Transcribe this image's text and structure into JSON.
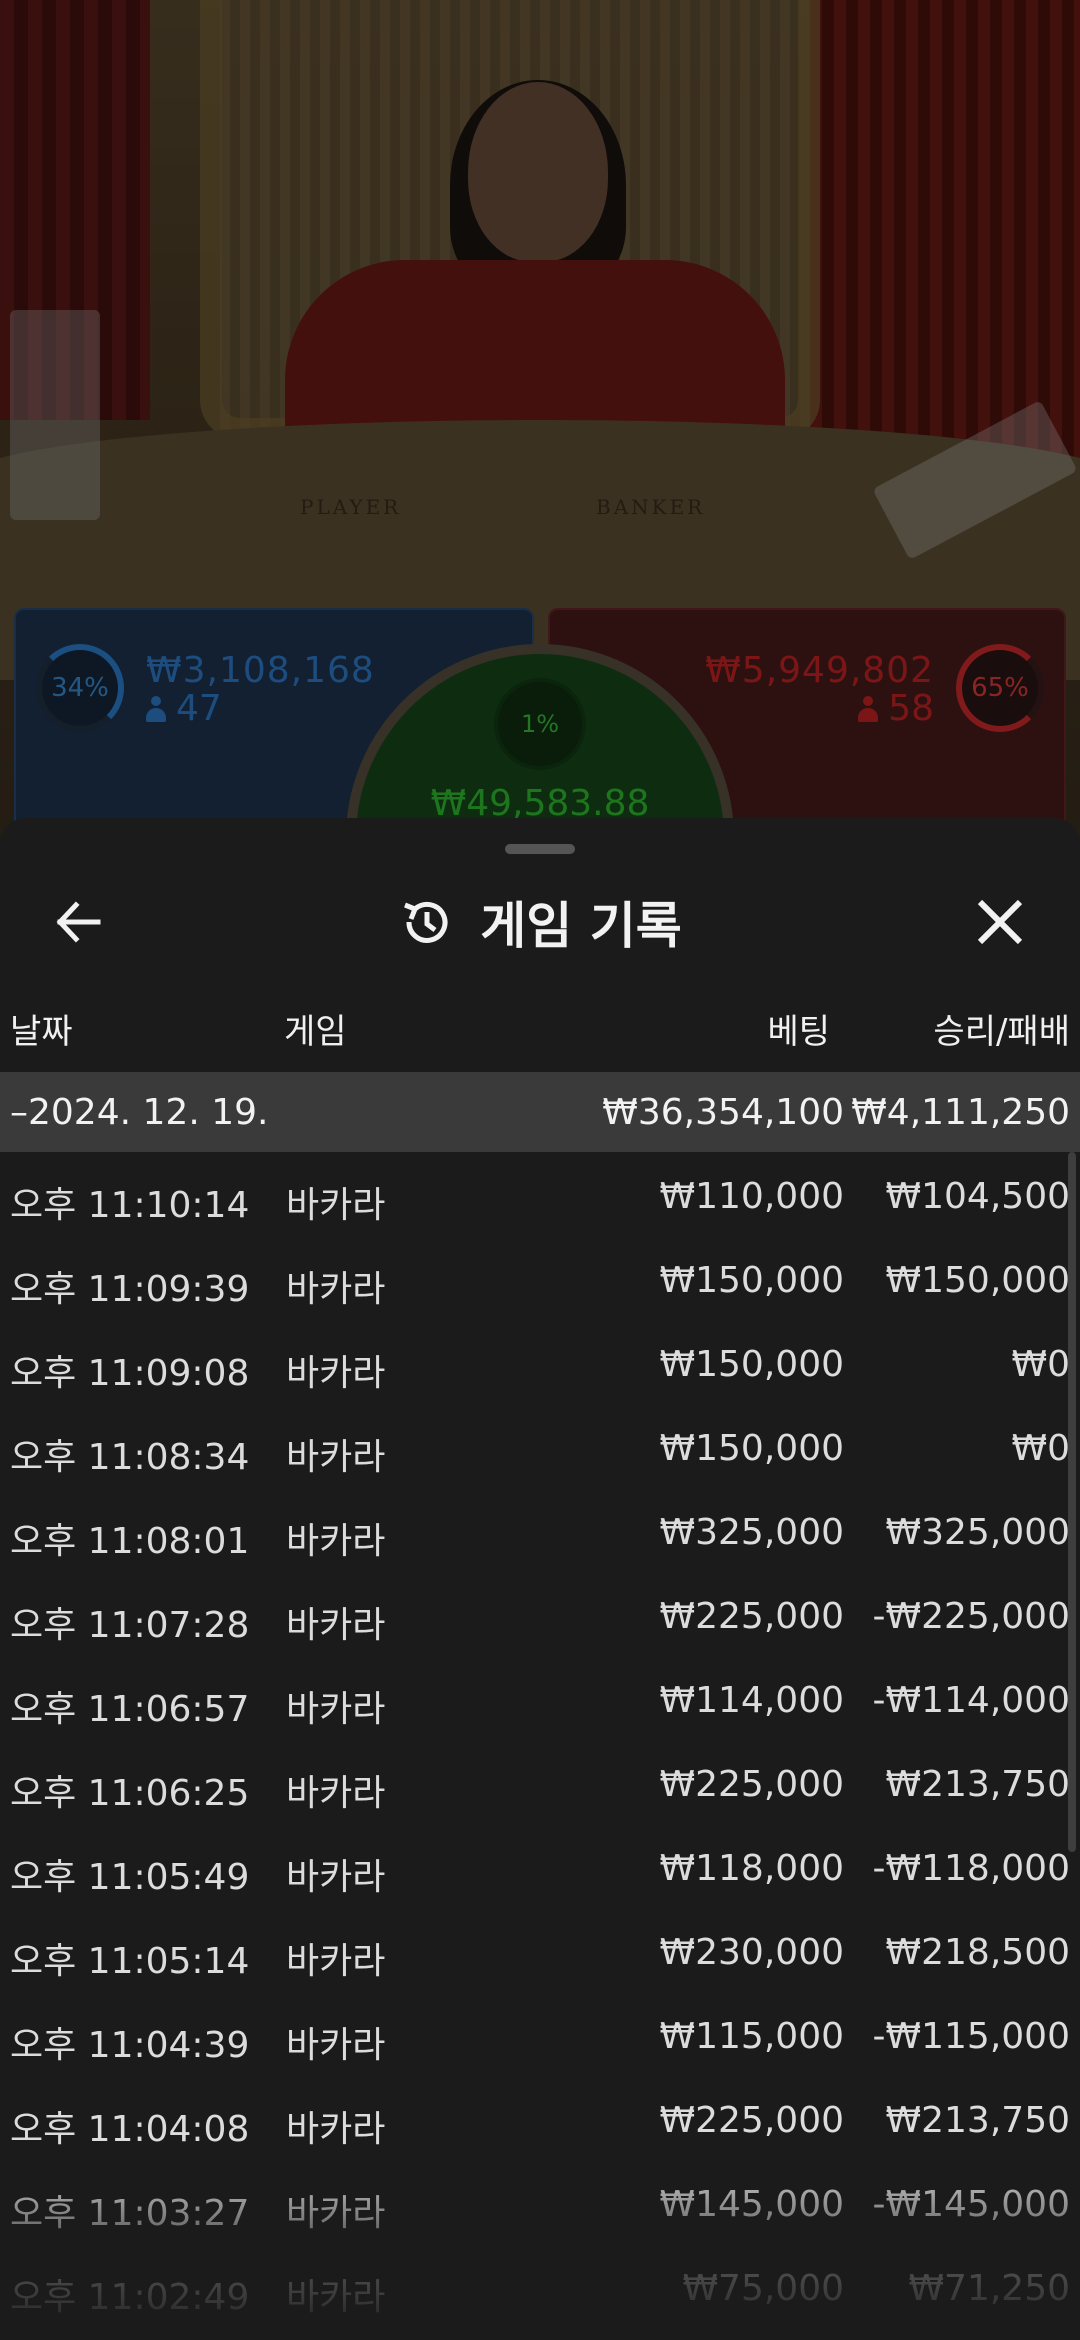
{
  "scene": {
    "table_player_label": "PLAYER",
    "table_banker_label": "BANKER",
    "player": {
      "percent": "34%",
      "amount": "₩3,108,168",
      "count": "47",
      "color": "#2f7ccb"
    },
    "banker": {
      "percent": "65%",
      "amount": "₩5,949,802",
      "count": "58",
      "color": "#c92525"
    },
    "tie": {
      "percent": "1%",
      "amount": "₩49,583.88",
      "color": "#2fbf2f"
    }
  },
  "sheet": {
    "title": "게임 기록",
    "icons": {
      "back": "arrow-left-icon",
      "history": "history-icon",
      "close": "close-icon"
    },
    "headers": {
      "date": "날짜",
      "game": "게임",
      "bet": "베팅",
      "winloss": "승리/패배"
    },
    "date_group": {
      "label": "–2024. 12. 19.",
      "bet": "₩36,354,100",
      "winloss": "₩4,111,250"
    },
    "rows": [
      {
        "time": "오후 11:10:14",
        "game": "바카라",
        "bet": "₩110,000",
        "winloss": "₩104,500"
      },
      {
        "time": "오후 11:09:39",
        "game": "바카라",
        "bet": "₩150,000",
        "winloss": "₩150,000"
      },
      {
        "time": "오후 11:09:08",
        "game": "바카라",
        "bet": "₩150,000",
        "winloss": "₩0"
      },
      {
        "time": "오후 11:08:34",
        "game": "바카라",
        "bet": "₩150,000",
        "winloss": "₩0"
      },
      {
        "time": "오후 11:08:01",
        "game": "바카라",
        "bet": "₩325,000",
        "winloss": "₩325,000"
      },
      {
        "time": "오후 11:07:28",
        "game": "바카라",
        "bet": "₩225,000",
        "winloss": "-₩225,000"
      },
      {
        "time": "오후 11:06:57",
        "game": "바카라",
        "bet": "₩114,000",
        "winloss": "-₩114,000"
      },
      {
        "time": "오후 11:06:25",
        "game": "바카라",
        "bet": "₩225,000",
        "winloss": "₩213,750"
      },
      {
        "time": "오후 11:05:49",
        "game": "바카라",
        "bet": "₩118,000",
        "winloss": "-₩118,000"
      },
      {
        "time": "오후 11:05:14",
        "game": "바카라",
        "bet": "₩230,000",
        "winloss": "₩218,500"
      },
      {
        "time": "오후 11:04:39",
        "game": "바카라",
        "bet": "₩115,000",
        "winloss": "-₩115,000"
      },
      {
        "time": "오후 11:04:08",
        "game": "바카라",
        "bet": "₩225,000",
        "winloss": "₩213,750"
      },
      {
        "time": "오후 11:03:27",
        "game": "바카라",
        "bet": "₩145,000",
        "winloss": "-₩145,000"
      },
      {
        "time": "오후 11:02:49",
        "game": "바카라",
        "bet": "₩75,000",
        "winloss": "₩71,250"
      }
    ]
  }
}
